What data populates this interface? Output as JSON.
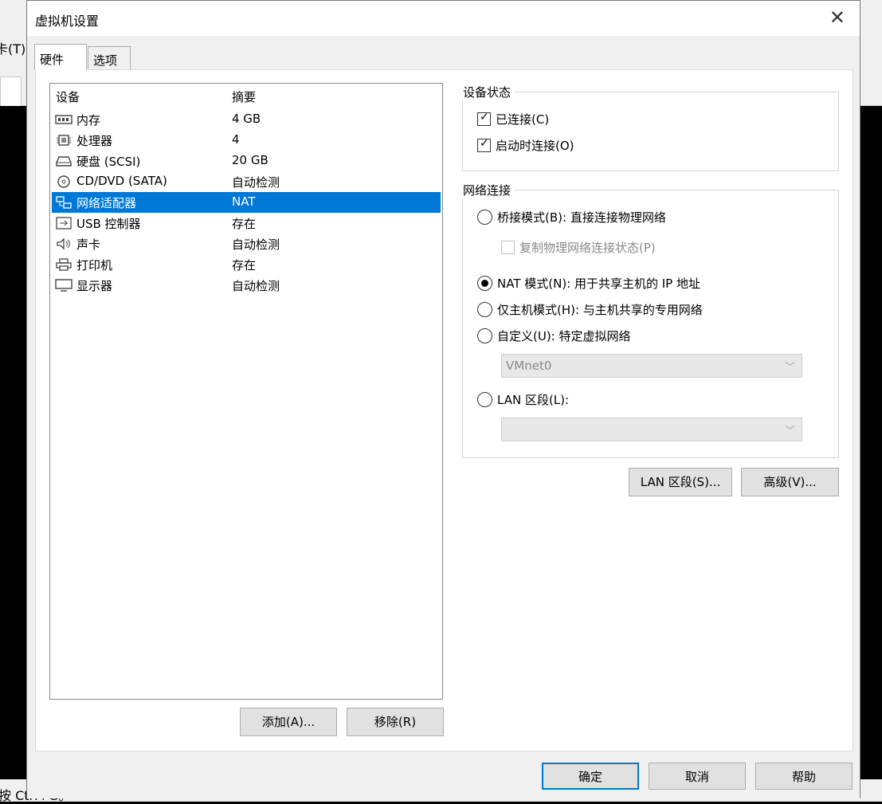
{
  "background": {
    "menu_fragment": "卡(T)",
    "status_fragment": "按 Ctrl+G。"
  },
  "dialog": {
    "title": "虚拟机设置",
    "close_glyph": "✕"
  },
  "tabs": [
    {
      "label": "硬件",
      "active": true
    },
    {
      "label": "选项",
      "active": false
    }
  ],
  "device_list": {
    "col_device": "设备",
    "col_summary": "摘要",
    "rows": [
      {
        "name": "内存",
        "summary": "4 GB",
        "icon": "memory-icon"
      },
      {
        "name": "处理器",
        "summary": "4",
        "icon": "processor-icon"
      },
      {
        "name": "硬盘 (SCSI)",
        "summary": "20 GB",
        "icon": "hard-disk-icon"
      },
      {
        "name": "CD/DVD (SATA)",
        "summary": "自动检测",
        "icon": "cd-dvd-icon"
      },
      {
        "name": "网络适配器",
        "summary": "NAT",
        "icon": "network-adapter-icon",
        "selected": true
      },
      {
        "name": "USB 控制器",
        "summary": "存在",
        "icon": "usb-icon"
      },
      {
        "name": "声卡",
        "summary": "自动检测",
        "icon": "sound-card-icon"
      },
      {
        "name": "打印机",
        "summary": "存在",
        "icon": "printer-icon"
      },
      {
        "name": "显示器",
        "summary": "自动检测",
        "icon": "display-icon"
      }
    ]
  },
  "list_buttons": {
    "add": "添加(A)...",
    "remove": "移除(R)"
  },
  "device_status": {
    "legend": "设备状态",
    "connected": {
      "label": "已连接(C)",
      "checked": true
    },
    "connect_at_power_on": {
      "label": "启动时连接(O)",
      "checked": true
    }
  },
  "network": {
    "legend": "网络连接",
    "bridged": {
      "label": "桥接模式(B): 直接连接物理网络",
      "checked": false
    },
    "replicate": {
      "label": "复制物理网络连接状态(P)",
      "checked": false
    },
    "nat": {
      "label": "NAT 模式(N): 用于共享主机的 IP 地址",
      "checked": true
    },
    "host_only": {
      "label": "仅主机模式(H): 与主机共享的专用网络",
      "checked": false
    },
    "custom": {
      "label": "自定义(U): 特定虚拟网络",
      "checked": false
    },
    "vmnet_value": "VMnet0",
    "lan_segment": {
      "label": "LAN 区段(L):",
      "checked": false
    },
    "lan_value": ""
  },
  "network_buttons": {
    "lan_segments": "LAN 区段(S)...",
    "advanced": "高级(V)..."
  },
  "footer": {
    "ok": "确定",
    "cancel": "取消",
    "help": "帮助"
  }
}
